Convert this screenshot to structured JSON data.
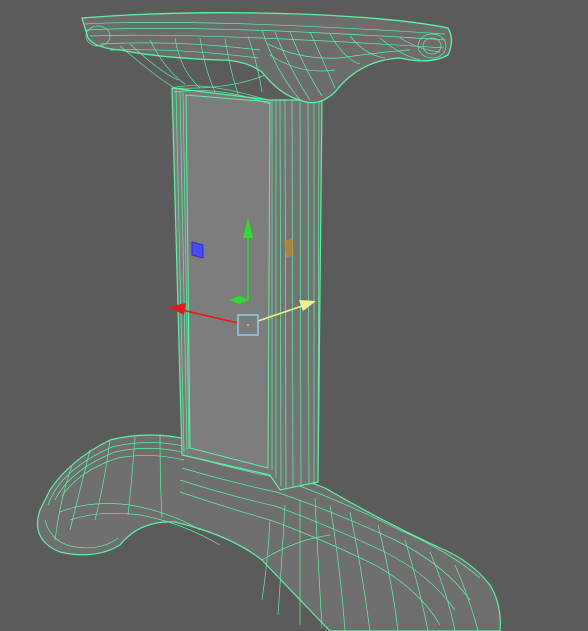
{
  "viewport": {
    "background": "#5b5b5b",
    "wireframe_color": "#5ef2a4",
    "face_color": "#7a7a7a"
  },
  "model": {
    "parts": [
      "top-cap",
      "column",
      "base-foot"
    ]
  },
  "gizmo": {
    "x_axis_color": "#e01a1a",
    "y_axis_color": "#2ee02e",
    "z_axis_color": "#f2f28a",
    "plane_handle_xy_color": "#4848ff",
    "plane_handle_yz_color": "#b88a2e",
    "center_handle_color": "#8ad2e8"
  }
}
